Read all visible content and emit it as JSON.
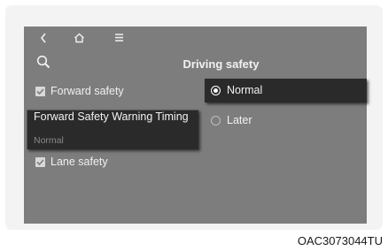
{
  "nav": {
    "back_icon": "back-chevron-icon",
    "home_icon": "home-icon",
    "menu_icon": "menu-icon",
    "search_icon": "search-icon"
  },
  "header": {
    "title": "Driving safety"
  },
  "left_list": [
    {
      "label": "Forward safety",
      "checked": true
    },
    {
      "label": "Lane safety",
      "checked": true
    }
  ],
  "tooltip": {
    "title": "Forward Safety Warning Timing",
    "value": "Normal"
  },
  "options": [
    {
      "label": "Normal",
      "selected": true
    },
    {
      "label": "Later",
      "selected": false
    }
  ],
  "caption": "OAC3073044TU",
  "colors": {
    "screen_bg": "#7d7d7d",
    "panel_dark": "#2a2a2a",
    "text": "#f2f2f2"
  }
}
